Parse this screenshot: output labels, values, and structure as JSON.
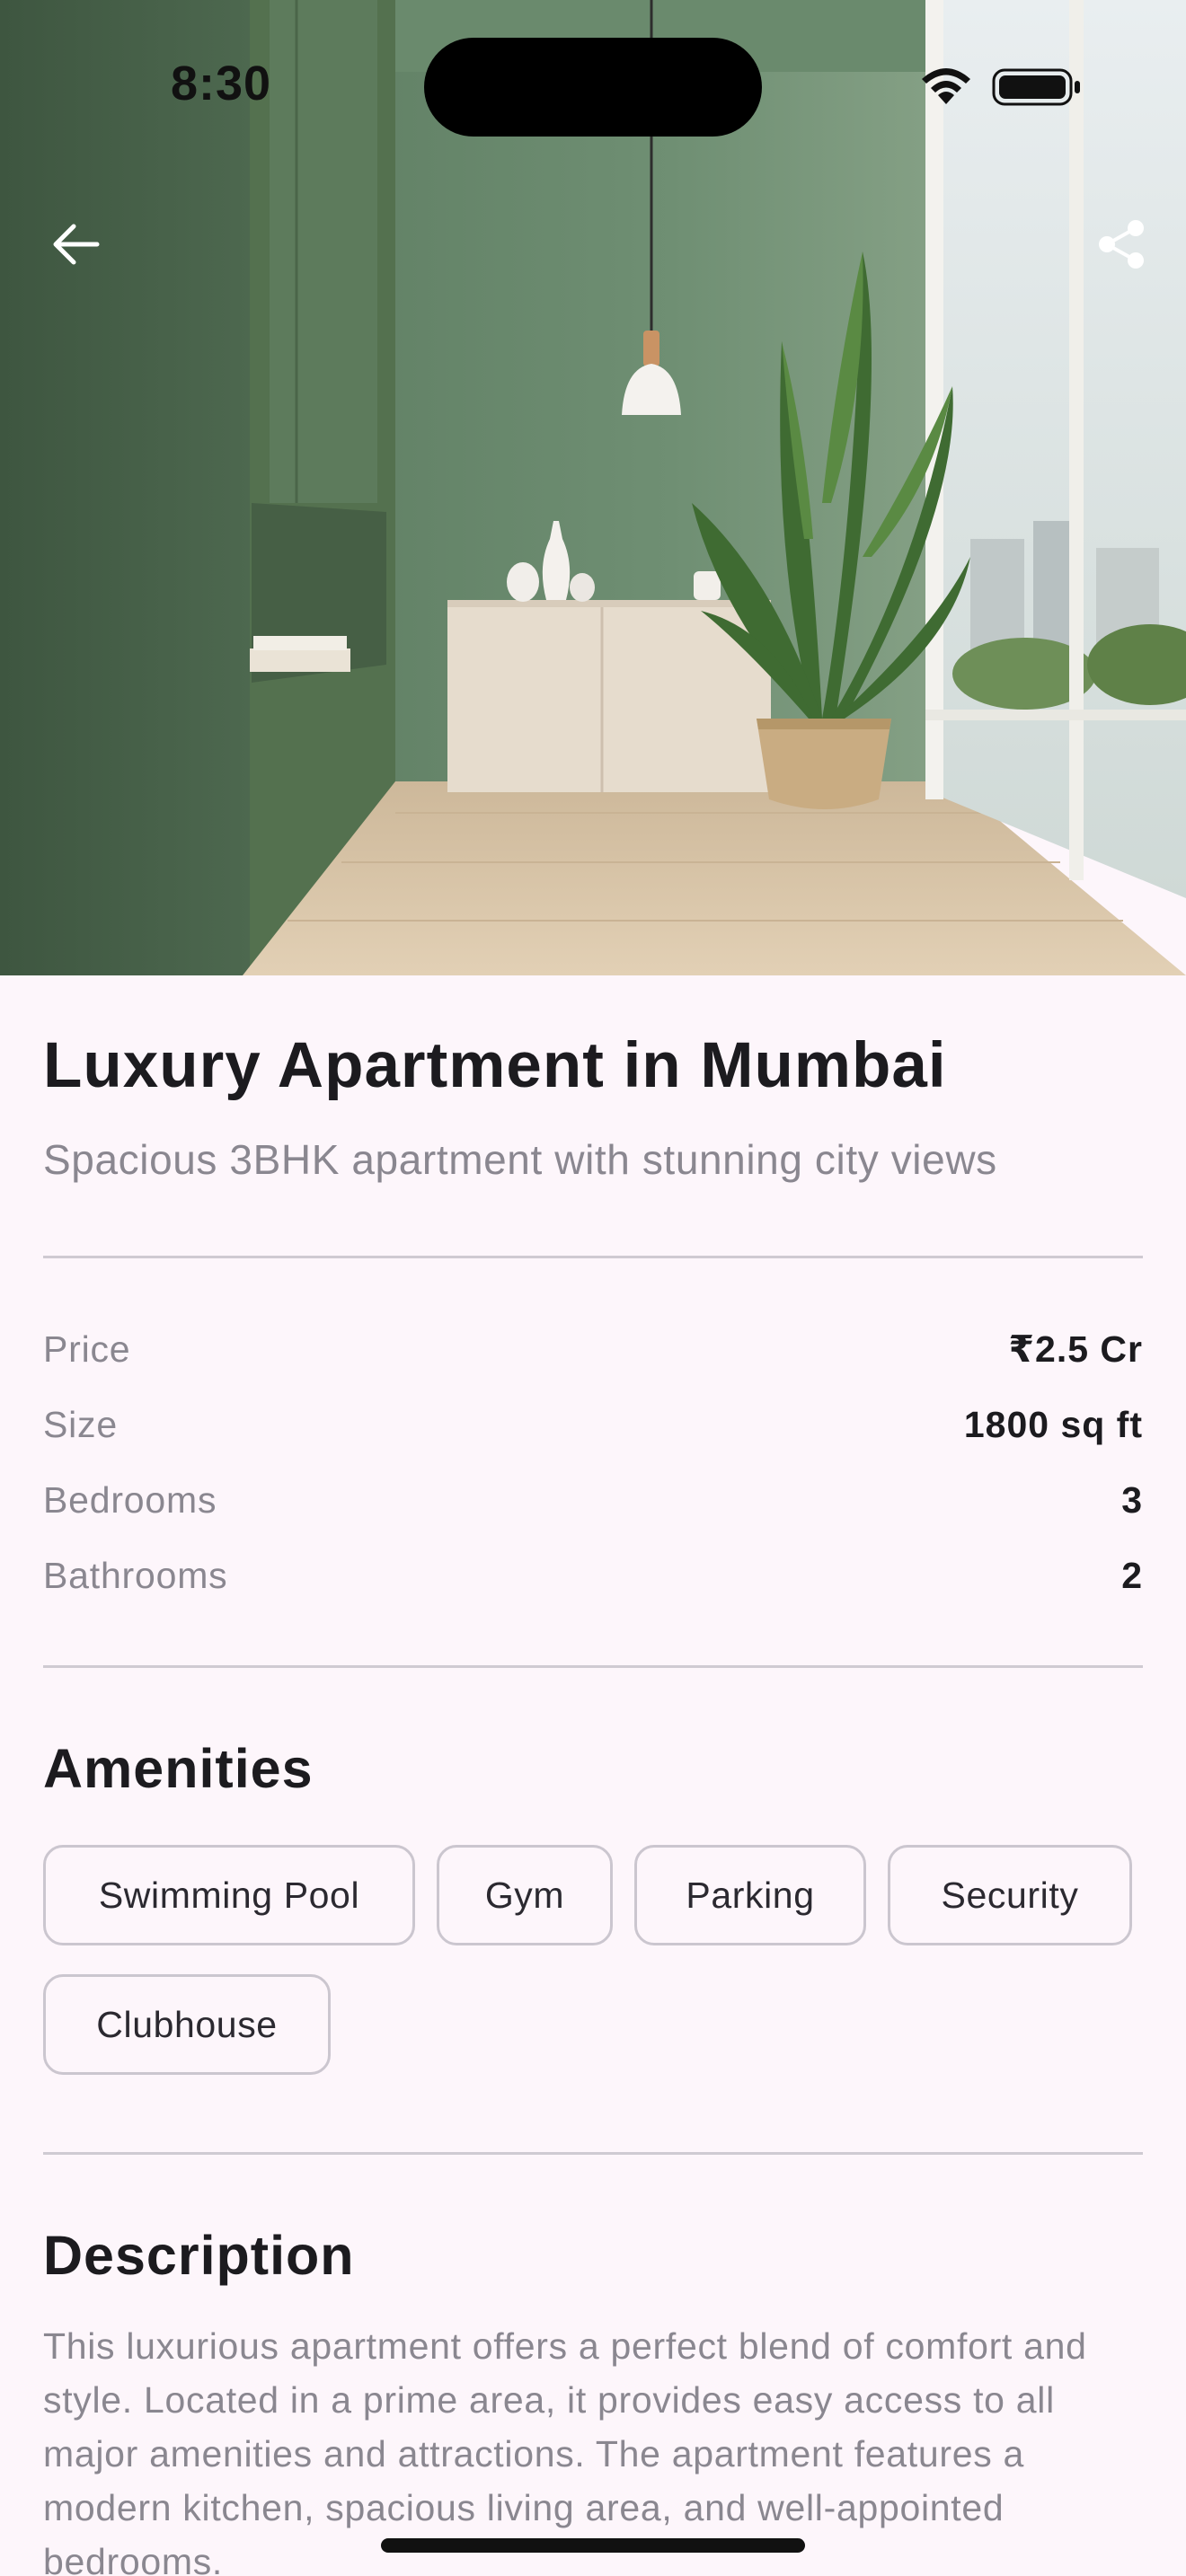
{
  "status_bar": {
    "time": "8:30"
  },
  "listing": {
    "title": "Luxury Apartment in Mumbai",
    "subtitle": "Spacious 3BHK apartment with stunning city views"
  },
  "specs": [
    {
      "label": "Price",
      "value": "₹2.5 Cr"
    },
    {
      "label": "Size",
      "value": "1800 sq ft"
    },
    {
      "label": "Bedrooms",
      "value": "3"
    },
    {
      "label": "Bathrooms",
      "value": "2"
    }
  ],
  "amenities": {
    "heading": "Amenities",
    "items": [
      "Swimming Pool",
      "Gym",
      "Parking",
      "Security",
      "Clubhouse"
    ]
  },
  "description": {
    "heading": "Description",
    "text": "This luxurious apartment offers a perfect blend of comfort and style. Located in a prime area, it provides easy access to all major amenities and attractions. The apartment features a modern kitchen, spacious living area, and well-appointed bedrooms."
  },
  "icons": {
    "back": "arrow-left-icon",
    "share": "share-icon",
    "wifi": "wifi-icon",
    "battery": "battery-icon"
  },
  "colors": {
    "background": "#fdf6fb",
    "text_primary": "#1c1b1f",
    "text_secondary": "#8a8790",
    "chip_border": "#cbc6cf",
    "wall_green": "#6b8a6e"
  }
}
